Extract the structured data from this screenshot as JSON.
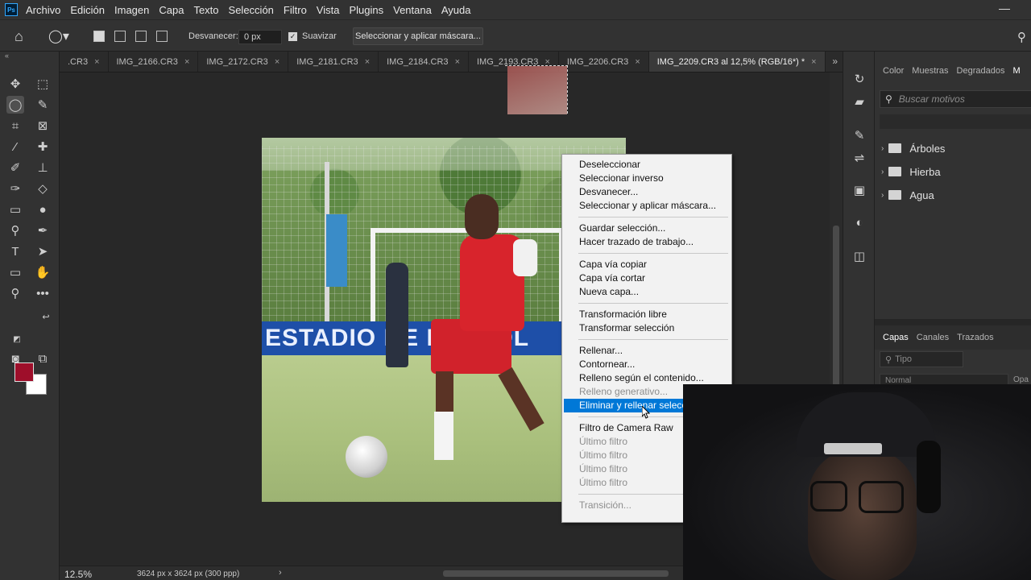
{
  "menubar": {
    "logo": "Ps",
    "items": [
      "Archivo",
      "Edición",
      "Imagen",
      "Capa",
      "Texto",
      "Selección",
      "Filtro",
      "Vista",
      "Plugins",
      "Ventana",
      "Ayuda"
    ],
    "minimize": "—"
  },
  "options": {
    "feather_label": "Desvanecer:",
    "feather_value": "0 px",
    "smooth_label": "Suavizar",
    "mask_button": "Seleccionar y aplicar máscara..."
  },
  "tabs": {
    "items": [
      {
        "label": ".CR3"
      },
      {
        "label": "IMG_2166.CR3"
      },
      {
        "label": "IMG_2172.CR3"
      },
      {
        "label": "IMG_2181.CR3"
      },
      {
        "label": "IMG_2184.CR3"
      },
      {
        "label": "IMG_2193.CR3"
      },
      {
        "label": "IMG_2206.CR3"
      },
      {
        "label": "IMG_2209.CR3 al 12,5% (RGB/16*) *",
        "active": true
      }
    ],
    "close": "×",
    "more": "»"
  },
  "photo": {
    "banner_text": "ESTADIO DE FÚTBOL"
  },
  "context_menu": {
    "items": [
      {
        "label": "Deseleccionar"
      },
      {
        "label": "Seleccionar inverso"
      },
      {
        "label": "Desvanecer..."
      },
      {
        "label": "Seleccionar y aplicar máscara..."
      },
      {
        "sep": true
      },
      {
        "label": "Guardar selección..."
      },
      {
        "label": "Hacer trazado de trabajo..."
      },
      {
        "sep": true
      },
      {
        "label": "Capa vía copiar"
      },
      {
        "label": "Capa vía cortar"
      },
      {
        "label": "Nueva capa..."
      },
      {
        "sep": true
      },
      {
        "label": "Transformación libre"
      },
      {
        "label": "Transformar selección"
      },
      {
        "sep": true
      },
      {
        "label": "Rellenar..."
      },
      {
        "label": "Contornear..."
      },
      {
        "label": "Relleno según el contenido..."
      },
      {
        "label": "Relleno generativo...",
        "disabled": true
      },
      {
        "label": "Eliminar y rellenar selección",
        "highlighted": true
      },
      {
        "sep": true
      },
      {
        "label": "Filtro de Camera Raw"
      },
      {
        "label": "Último filtro",
        "disabled": true
      },
      {
        "label": "Último filtro",
        "disabled": true
      },
      {
        "label": "Último filtro",
        "disabled": true
      },
      {
        "label": "Último filtro",
        "disabled": true
      },
      {
        "sep": true
      },
      {
        "label": "Transición...",
        "disabled": true
      }
    ]
  },
  "right_panel": {
    "tabs": [
      "Color",
      "Muestras",
      "Degradados",
      "M"
    ],
    "search_placeholder": "Buscar motivos",
    "folders": [
      "Árboles",
      "Hierba",
      "Agua"
    ],
    "layer_tabs": [
      "Capas",
      "Canales",
      "Trazados"
    ],
    "layer_filter": "Tipo",
    "blend_mode": "Normal",
    "opacity_label": "Opa"
  },
  "status": {
    "zoom": "12.5%",
    "doc_size": "3624 px x 3624 px (300 ppp)",
    "arrow": "›"
  },
  "colors": {
    "foreground": "#9e0e2a",
    "background": "#ffffff",
    "highlight": "#0078d7"
  }
}
